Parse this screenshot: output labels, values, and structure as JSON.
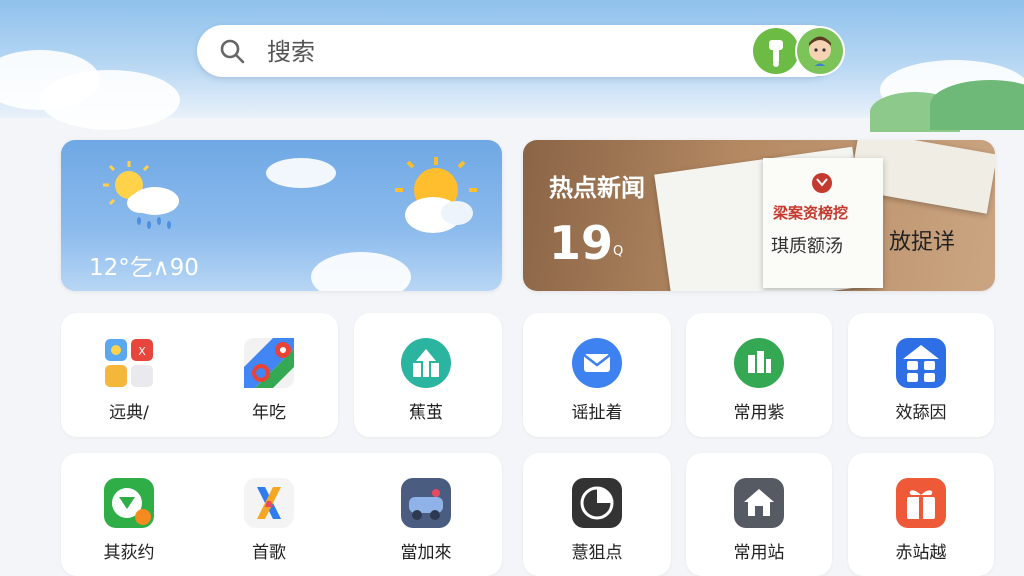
{
  "search": {
    "placeholder": "搜索"
  },
  "weather": {
    "temperature": "12°乞∧90"
  },
  "news": {
    "title": "热点新闻",
    "count": "19",
    "unit": "Q",
    "paper_title": "梁案资榜挖",
    "paper_sub": "琪质额汤",
    "aside": "放捉详"
  },
  "apps_row1": [
    {
      "label": "远典/",
      "icon": "app-folder-icon"
    },
    {
      "label": "年吃",
      "icon": "maps-icon"
    },
    {
      "label": "蕉茧",
      "icon": "upload-icon"
    },
    {
      "label": "谣扯着",
      "icon": "mail-icon"
    },
    {
      "label": "常用紫",
      "icon": "building-icon"
    },
    {
      "label": "效舔因",
      "icon": "grid-apps-icon"
    }
  ],
  "apps_row2": [
    {
      "label": "其荻约",
      "icon": "green-badge-icon"
    },
    {
      "label": "首歌",
      "icon": "x-logo-icon"
    },
    {
      "label": "當加來",
      "icon": "car-icon"
    },
    {
      "label": "薏狙点",
      "icon": "pie-chart-icon"
    },
    {
      "label": "常用站",
      "icon": "home-icon"
    },
    {
      "label": "赤站越",
      "icon": "gift-icon"
    }
  ]
}
